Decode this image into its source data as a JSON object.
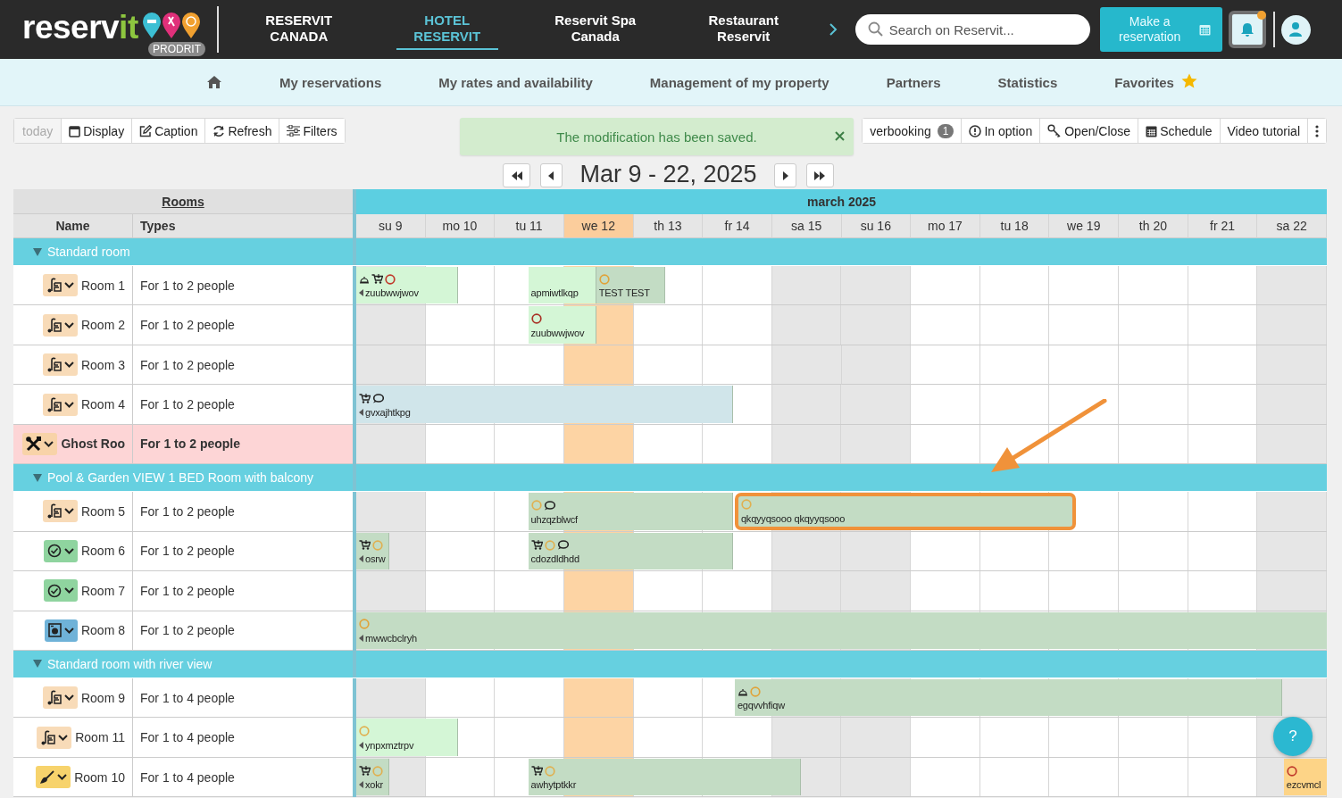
{
  "header": {
    "logo": {
      "name": "reserv",
      "accent": "it",
      "badge": "PRODRIT"
    },
    "tabs": [
      {
        "label": "RESERVIT CANADA",
        "selected": false
      },
      {
        "label": "HOTEL RESERVIT",
        "selected": true
      },
      {
        "label": "Reservit Spa Canada",
        "selected": false
      },
      {
        "label": "Restaurant Reservit",
        "selected": false
      }
    ],
    "search": {
      "placeholder": "Search on Reservit..."
    },
    "reserve_button": "Make a reservation",
    "notifications": {
      "unread": true
    }
  },
  "menu": [
    {
      "label": "My reservations",
      "starred": false
    },
    {
      "label": "My rates and availability",
      "starred": false
    },
    {
      "label": "Management of my property",
      "starred": false
    },
    {
      "label": "Partners",
      "starred": false
    },
    {
      "label": "Statistics",
      "starred": false
    },
    {
      "label": "Favorites",
      "starred": true
    }
  ],
  "toolbar": {
    "left": [
      {
        "label": "today",
        "kind": "text",
        "disabled": true
      },
      {
        "label": "Display",
        "kind": "calendar",
        "disabled": false
      },
      {
        "label": "Caption",
        "kind": "edit",
        "disabled": false
      },
      {
        "label": "Refresh",
        "kind": "refresh",
        "disabled": false
      },
      {
        "label": "Filters",
        "kind": "sliders",
        "disabled": false
      }
    ],
    "right": [
      {
        "label": "verbooking",
        "kind": "count",
        "badge": "1"
      },
      {
        "label": "In option",
        "kind": "alert"
      },
      {
        "label": "Open/Close",
        "kind": "key"
      },
      {
        "label": "Schedule",
        "kind": "calendar"
      },
      {
        "label": "Video tutorial",
        "kind": "text"
      },
      {
        "kind": "more"
      }
    ]
  },
  "toast": {
    "message": "The modification has been saved."
  },
  "period": "Mar 9 - 22, 2025",
  "planner": {
    "rooms_heading": "Rooms",
    "month": "march 2025",
    "columns": [
      "Name",
      "Types"
    ],
    "days": [
      {
        "label": "su 9",
        "weekend": true,
        "today": false
      },
      {
        "label": "mo 10",
        "weekend": false,
        "today": false
      },
      {
        "label": "tu 11",
        "weekend": false,
        "today": false
      },
      {
        "label": "we 12",
        "weekend": false,
        "today": true
      },
      {
        "label": "th 13",
        "weekend": false,
        "today": false
      },
      {
        "label": "fr 14",
        "weekend": false,
        "today": false
      },
      {
        "label": "sa 15",
        "weekend": true,
        "today": false
      },
      {
        "label": "su 16",
        "weekend": true,
        "today": false
      },
      {
        "label": "mo 17",
        "weekend": false,
        "today": false
      },
      {
        "label": "tu 18",
        "weekend": false,
        "today": false
      },
      {
        "label": "we 19",
        "weekend": false,
        "today": false
      },
      {
        "label": "th 20",
        "weekend": false,
        "today": false
      },
      {
        "label": "fr 21",
        "weekend": false,
        "today": false
      },
      {
        "label": "sa 22",
        "weekend": true,
        "today": false
      }
    ],
    "groups": [
      {
        "name": "Standard room",
        "expanded": true,
        "rooms": [
          {
            "name": "Room 1",
            "type": "For 1 to 2 people",
            "ghost": false,
            "status": {
              "kind": "vacuum",
              "color": "#f8dbb8"
            },
            "bookings": [
              {
                "guest": "zuubwwjwov",
                "continues_before": true,
                "continues_after": false,
                "color": "#d4f6d6",
                "highlighted": false,
                "icons": [
                  {
                    "kind": "bell"
                  },
                  {
                    "kind": "cart"
                  },
                  {
                    "kind": "status",
                    "color": "#c0392b"
                  }
                ]
              },
              {
                "guest": "apmiwtlkqp",
                "continues_before": false,
                "continues_after": false,
                "color": "#d4f6d6",
                "highlighted": false
              },
              {
                "guest": "TEST TEST",
                "continues_before": false,
                "continues_after": false,
                "color": "#c3dcc4",
                "highlighted": false,
                "icons": [
                  {
                    "kind": "status",
                    "color": "#e0a33a"
                  }
                ]
              }
            ]
          },
          {
            "name": "Room 2",
            "type": "For 1 to 2 people",
            "ghost": false,
            "status": {
              "kind": "vacuum",
              "color": "#f8dbb8"
            },
            "bookings": [
              {
                "guest": "zuubwwjwov",
                "continues_before": false,
                "continues_after": false,
                "color": "#d4f6d6",
                "highlighted": false,
                "icons": [
                  {
                    "kind": "status",
                    "color": "#a93226"
                  }
                ]
              }
            ]
          },
          {
            "name": "Room 3",
            "type": "For 1 to 2 people",
            "ghost": false,
            "status": {
              "kind": "vacuum",
              "color": "#f8dbb8"
            }
          },
          {
            "name": "Room 4",
            "type": "For 1 to 2 people",
            "ghost": false,
            "status": {
              "kind": "vacuum",
              "color": "#f8dbb8"
            },
            "bookings": [
              {
                "guest": "gvxajhtkpg",
                "continues_before": true,
                "continues_after": false,
                "color": "#d0e5ea",
                "highlighted": false,
                "icons": [
                  {
                    "kind": "cart"
                  },
                  {
                    "kind": "bubble"
                  }
                ]
              }
            ]
          },
          {
            "name": "Ghost Roo",
            "type": "For 1 to 2 people",
            "ghost": true,
            "status": {
              "kind": "tools",
              "color": "#f8d3a8"
            }
          }
        ]
      },
      {
        "name": "Pool & Garden VIEW 1 BED Room with balcony",
        "expanded": true,
        "rooms": [
          {
            "name": "Room 5",
            "type": "For 1 to 2 people",
            "ghost": false,
            "status": {
              "kind": "vacuum",
              "color": "#f8dbb8"
            },
            "bookings": [
              {
                "guest": "uhzqzblwcf",
                "continues_before": false,
                "continues_after": false,
                "color": "#c3dcc4",
                "highlighted": false,
                "icons": [
                  {
                    "kind": "status",
                    "color": "#e0b050"
                  },
                  {
                    "kind": "bubble"
                  }
                ]
              },
              {
                "guest": "qkqyyqsooo qkqyyqsooo",
                "continues_before": false,
                "continues_after": false,
                "color": "#c3dcc4",
                "highlighted": true,
                "icons": [
                  {
                    "kind": "status",
                    "color": "#e0b050"
                  }
                ]
              }
            ]
          },
          {
            "name": "Room 6",
            "type": "For 1 to 2 people",
            "ghost": false,
            "status": {
              "kind": "check",
              "color": "#8fd49f"
            },
            "bookings": [
              {
                "guest": "osrw",
                "continues_before": true,
                "continues_after": false,
                "color": "#c3dcc4",
                "highlighted": false,
                "icons": [
                  {
                    "kind": "cart"
                  },
                  {
                    "kind": "status",
                    "color": "#e0b050"
                  }
                ]
              },
              {
                "guest": "cdozdldhdd",
                "continues_before": false,
                "continues_after": false,
                "color": "#c3dcc4",
                "highlighted": false,
                "icons": [
                  {
                    "kind": "cart"
                  },
                  {
                    "kind": "status",
                    "color": "#e0b050"
                  },
                  {
                    "kind": "bubble"
                  }
                ]
              }
            ]
          },
          {
            "name": "Room 7",
            "type": "For 1 to 2 people",
            "ghost": false,
            "status": {
              "kind": "check",
              "color": "#8fd49f"
            }
          },
          {
            "name": "Room 8",
            "type": "For 1 to 2 people",
            "ghost": false,
            "status": {
              "kind": "washer",
              "color": "#6fb2d8"
            },
            "bookings": [
              {
                "guest": "mwwcbclryh",
                "continues_before": true,
                "continues_after": true,
                "color": "#c3dcc4",
                "highlighted": false,
                "icons": [
                  {
                    "kind": "status",
                    "color": "#e0a33a"
                  }
                ]
              }
            ]
          }
        ]
      },
      {
        "name": "Standard room with river view",
        "expanded": true,
        "rooms": [
          {
            "name": "Room 9",
            "type": "For 1 to 4 people",
            "ghost": false,
            "status": {
              "kind": "vacuum",
              "color": "#f8dbb8"
            },
            "bookings": [
              {
                "guest": "egqvvhfiqw",
                "continues_before": false,
                "continues_after": false,
                "color": "#c3dcc4",
                "highlighted": false,
                "icons": [
                  {
                    "kind": "bell"
                  },
                  {
                    "kind": "status",
                    "color": "#e0a33a"
                  }
                ]
              }
            ]
          },
          {
            "name": "Room 11",
            "type": "For 1 to 4 people",
            "ghost": false,
            "status": {
              "kind": "vacuum",
              "color": "#f8dbb8"
            },
            "bookings": [
              {
                "guest": "ynpxmztrpv",
                "continues_before": true,
                "continues_after": false,
                "color": "#d4f6d6",
                "highlighted": false,
                "icons": [
                  {
                    "kind": "status",
                    "color": "#e0b050"
                  }
                ]
              }
            ]
          },
          {
            "name": "Room 10",
            "type": "For 1 to 4 people",
            "ghost": false,
            "status": {
              "kind": "brush",
              "color": "#f7d36c"
            },
            "bookings": [
              {
                "guest": "xokr",
                "continues_before": true,
                "continues_after": false,
                "color": "#c3dcc4",
                "highlighted": false,
                "icons": [
                  {
                    "kind": "cart"
                  },
                  {
                    "kind": "status",
                    "color": "#e0b050"
                  }
                ]
              },
              {
                "guest": "awhytptkkr",
                "continues_before": false,
                "continues_after": false,
                "color": "#c3dcc4",
                "highlighted": false,
                "icons": [
                  {
                    "kind": "cart"
                  },
                  {
                    "kind": "status",
                    "color": "#e0b050"
                  }
                ]
              },
              {
                "guest": "ezcvmcl",
                "continues_before": false,
                "continues_after": true,
                "color": "#fdd487",
                "highlighted": false,
                "icons": [
                  {
                    "kind": "status",
                    "color": "#c0392b"
                  }
                ]
              }
            ]
          }
        ]
      }
    ]
  },
  "help": "?"
}
